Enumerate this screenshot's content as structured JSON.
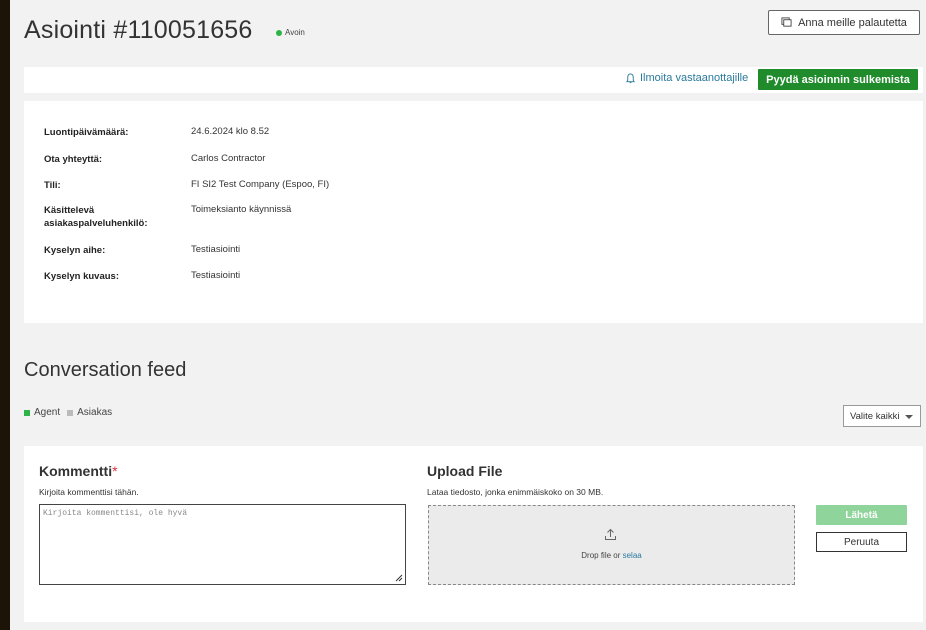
{
  "header": {
    "title": "Asiointi #110051656",
    "status": "Avoin",
    "feedback_button": "Anna meille palautetta"
  },
  "actions": {
    "notify_label": "Ilmoita vastaanottajille",
    "close_request_button": "Pyydä asioinnin sulkemista"
  },
  "details": [
    {
      "label": "Luontipäivämäärä:",
      "value": "24.6.2024 klo 8.52"
    },
    {
      "label": "Ota yhteyttä:",
      "value": "Carlos Contractor"
    },
    {
      "label": "Tili:",
      "value": "FI SI2 Test Company (Espoo, FI)"
    },
    {
      "label": "Käsittelevä asiakaspalveluhenkilö:",
      "value": "Toimeksianto käynnissä"
    },
    {
      "label": "Kyselyn aihe:",
      "value": "Testiasiointi"
    },
    {
      "label": "Kyselyn kuvaus:",
      "value": "Testiasiointi"
    }
  ],
  "conversation": {
    "title": "Conversation feed",
    "legend_agent": "Agent",
    "legend_customer": "Asiakas",
    "filter_label": "Valite kaikki"
  },
  "comment": {
    "title": "Kommentti",
    "required_mark": "*",
    "help": "Kirjoita kommenttisi tähän.",
    "placeholder": "Kirjoita kommenttisi, ole hyvä"
  },
  "upload": {
    "title": "Upload File",
    "help": "Lataa tiedosto, jonka enimmäiskoko on 30 MB.",
    "drop_text": "Drop file or",
    "browse_link": "selaa"
  },
  "buttons": {
    "send": "Lähetä",
    "cancel": "Peruuta"
  },
  "colors": {
    "accent_green": "#1f8b2a",
    "send_disabled": "#8fd49a",
    "status_dot": "#2eb347",
    "link": "#2b7a9c",
    "agent_legend": "#2eb347",
    "customer_legend": "#bbbbbb"
  }
}
